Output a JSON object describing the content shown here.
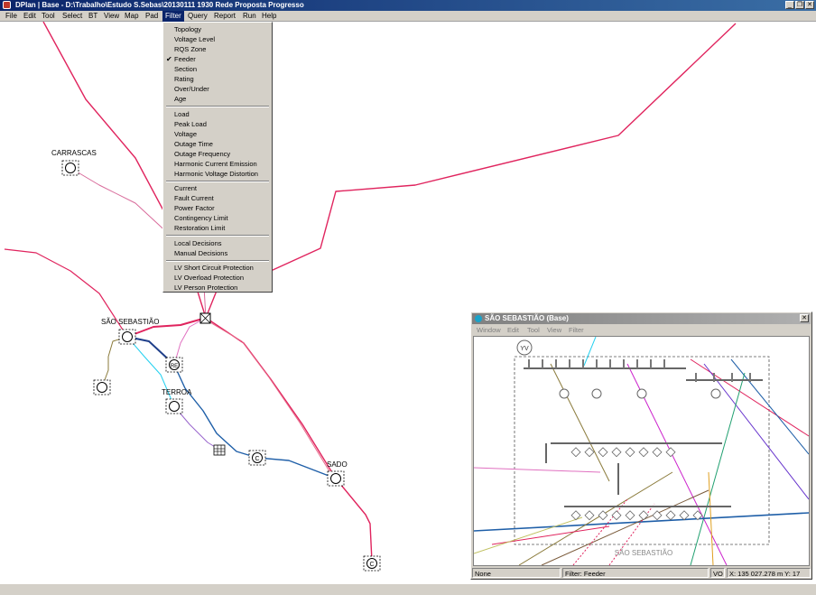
{
  "window": {
    "title": "DPlan  |  Base - D:\\Trabalho\\Estudo S.Sebas\\20130111 1930 Rede Proposta Progresso",
    "app_icon": "dplan-app-icon",
    "buttons": {
      "minimize": "_",
      "restore": "❐",
      "close": "✕"
    }
  },
  "menubar": {
    "items": [
      {
        "label": "File"
      },
      {
        "label": "Edit"
      },
      {
        "label": "Tool"
      },
      {
        "label": "Select"
      },
      {
        "label": "BT"
      },
      {
        "label": "View"
      },
      {
        "label": "Map"
      },
      {
        "label": "Pad"
      },
      {
        "label": "Filter"
      },
      {
        "label": "Query"
      },
      {
        "label": "Report"
      },
      {
        "label": "Run"
      },
      {
        "label": "Help"
      }
    ],
    "active": "Filter"
  },
  "filter_menu": {
    "checked": "Feeder",
    "groups": [
      [
        "Topology",
        "Voltage Level",
        "RQS Zone",
        "Feeder",
        "Section",
        "Rating",
        "Over/Under",
        "Age"
      ],
      [
        "Load",
        "Peak Load",
        "Voltage",
        "Outage Time",
        "Outage Frequency",
        "Harmonic Current Emission",
        "Harmonic Voltage Distortion"
      ],
      [
        "Current",
        "Fault Current",
        "Power Factor",
        "Contingency Limit",
        "Restoration Limit"
      ],
      [
        "Local Decisions",
        "Manual Decisions"
      ],
      [
        "LV Short Circuit Protection",
        "LV Overload Protection",
        "LV Person Protection"
      ]
    ]
  },
  "map": {
    "labels": {
      "carrascas": "CARRASCAS",
      "sao_sebastiao": "SÃO SEBASTIÃO",
      "terroa": "TERROA",
      "sado": "SADO"
    },
    "node_symbols": {
      "re": "RE",
      "c1": "C",
      "c2": "C"
    },
    "colors": {
      "feeder_red": "#e0245e",
      "feeder_blue": "#1f5fa8",
      "feeder_cyan": "#22d0f0",
      "feeder_purple": "#9966cc",
      "feeder_olive": "#8a7a3a"
    }
  },
  "subwindow": {
    "title": "SÃO SEBASTIÃO (Base)",
    "menu": [
      "Window",
      "Edit",
      "Tool",
      "View",
      "Filter"
    ],
    "canvas_label": "SÃO SEBASTIÃO",
    "badge": "YV",
    "status": {
      "selection": "None",
      "filter": "Filter: Feeder",
      "mode": "VO",
      "coords": "X: 135 027.278 m  Y: 17"
    }
  }
}
